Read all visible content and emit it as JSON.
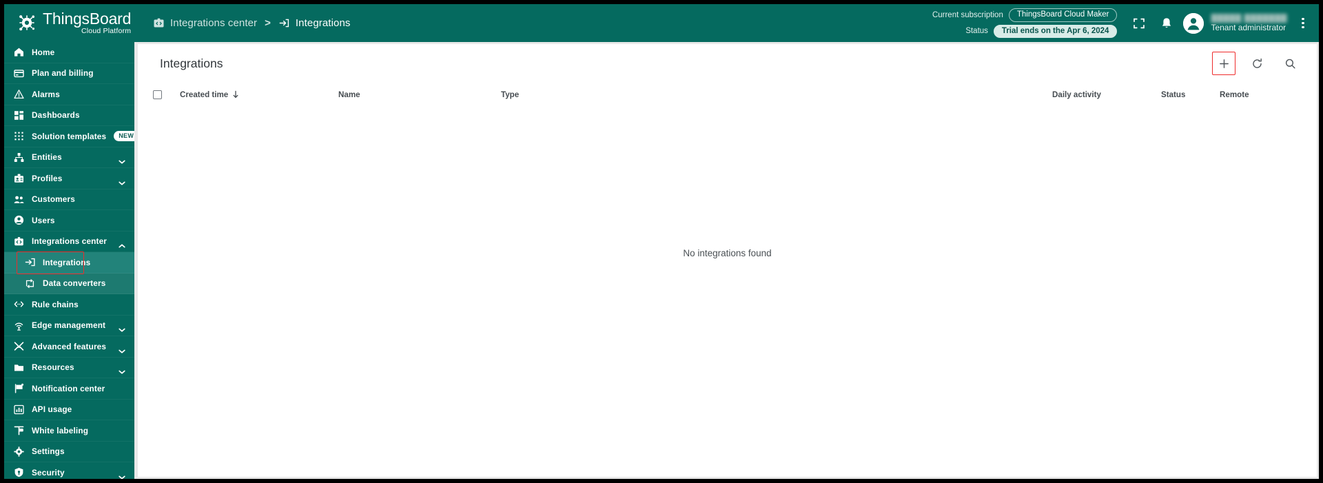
{
  "brand": {
    "name": "ThingsBoard",
    "tagline": "Cloud Platform",
    "logo_icon": "thingsboard-gear-logo",
    "primary_color": "#056A5F",
    "accent_highlight": "#ee2b2b"
  },
  "breadcrumb": {
    "items": [
      {
        "label": "Integrations center",
        "icon": "integrations-center-icon",
        "active": false
      },
      {
        "label": "Integrations",
        "icon": "integration-arrow-icon",
        "active": true
      }
    ],
    "separator": ">"
  },
  "header": {
    "subscription_label": "Current subscription",
    "subscription_value": "ThingsBoard Cloud Maker",
    "status_label": "Status",
    "status_value": "Trial ends on the Apr 6, 2024",
    "fullscreen_icon": "fullscreen-icon",
    "notifications_icon": "bell-icon",
    "avatar_icon": "user-avatar-icon",
    "user_name": "",
    "user_role": "Tenant administrator",
    "kebab_icon": "more-vertical-icon"
  },
  "sidebar": {
    "items": [
      {
        "label": "Home",
        "icon": "home-icon",
        "expandable": false,
        "badge": null,
        "child": false,
        "active": false
      },
      {
        "label": "Plan and billing",
        "icon": "credit-card-icon",
        "expandable": false,
        "badge": null,
        "child": false,
        "active": false
      },
      {
        "label": "Alarms",
        "icon": "alarm-triangle-icon",
        "expandable": false,
        "badge": null,
        "child": false,
        "active": false
      },
      {
        "label": "Dashboards",
        "icon": "dashboards-grid-icon",
        "expandable": false,
        "badge": null,
        "child": false,
        "active": false
      },
      {
        "label": "Solution templates",
        "icon": "solution-templates-icon",
        "expandable": false,
        "badge": "NEW",
        "child": false,
        "active": false
      },
      {
        "label": "Entities",
        "icon": "entities-hierarchy-icon",
        "expandable": true,
        "expanded": false,
        "badge": null,
        "child": false,
        "active": false
      },
      {
        "label": "Profiles",
        "icon": "profiles-briefcase-icon",
        "expandable": true,
        "expanded": false,
        "badge": null,
        "child": false,
        "active": false
      },
      {
        "label": "Customers",
        "icon": "customers-people-icon",
        "expandable": false,
        "badge": null,
        "child": false,
        "active": false
      },
      {
        "label": "Users",
        "icon": "user-circle-icon",
        "expandable": false,
        "badge": null,
        "child": false,
        "active": false
      },
      {
        "label": "Integrations center",
        "icon": "integrations-center-icon",
        "expandable": true,
        "expanded": true,
        "badge": null,
        "child": false,
        "active": false
      },
      {
        "label": "Integrations",
        "icon": "integration-arrow-icon",
        "expandable": false,
        "badge": null,
        "child": true,
        "active": true
      },
      {
        "label": "Data converters",
        "icon": "data-converters-icon",
        "expandable": false,
        "badge": null,
        "child": true,
        "active": false
      },
      {
        "label": "Rule chains",
        "icon": "rule-chains-icon",
        "expandable": false,
        "badge": null,
        "child": false,
        "active": false
      },
      {
        "label": "Edge management",
        "icon": "edge-management-icon",
        "expandable": true,
        "expanded": false,
        "badge": null,
        "child": false,
        "active": false
      },
      {
        "label": "Advanced features",
        "icon": "advanced-features-tools-icon",
        "expandable": true,
        "expanded": false,
        "badge": null,
        "child": false,
        "active": false
      },
      {
        "label": "Resources",
        "icon": "folder-icon",
        "expandable": true,
        "expanded": false,
        "badge": null,
        "child": false,
        "active": false
      },
      {
        "label": "Notification center",
        "icon": "notification-flag-icon",
        "expandable": false,
        "badge": null,
        "child": false,
        "active": false
      },
      {
        "label": "API usage",
        "icon": "api-usage-chart-icon",
        "expandable": false,
        "badge": null,
        "child": false,
        "active": false
      },
      {
        "label": "White labeling",
        "icon": "white-labeling-icon",
        "expandable": false,
        "badge": null,
        "child": false,
        "active": false
      },
      {
        "label": "Settings",
        "icon": "settings-gear-icon",
        "expandable": false,
        "badge": null,
        "child": false,
        "active": false
      },
      {
        "label": "Security",
        "icon": "security-shield-icon",
        "expandable": true,
        "expanded": false,
        "badge": null,
        "child": false,
        "active": false
      }
    ]
  },
  "main": {
    "title": "Integrations",
    "actions": [
      {
        "name": "add-integration-button",
        "icon": "plus-icon",
        "highlighted": true
      },
      {
        "name": "refresh-button",
        "icon": "refresh-icon",
        "highlighted": false
      },
      {
        "name": "search-button",
        "icon": "search-icon",
        "highlighted": false
      }
    ],
    "table": {
      "select_all_checkbox_checked": false,
      "sort_column": "Created time",
      "sort_direction": "desc",
      "columns": [
        {
          "label": "Created time",
          "sortable": true
        },
        {
          "label": "Name",
          "sortable": true
        },
        {
          "label": "Type",
          "sortable": true
        },
        {
          "label": "Daily activity",
          "sortable": true
        },
        {
          "label": "Status",
          "sortable": true
        },
        {
          "label": "Remote",
          "sortable": true
        }
      ],
      "rows": [],
      "empty_message": "No integrations found"
    }
  }
}
